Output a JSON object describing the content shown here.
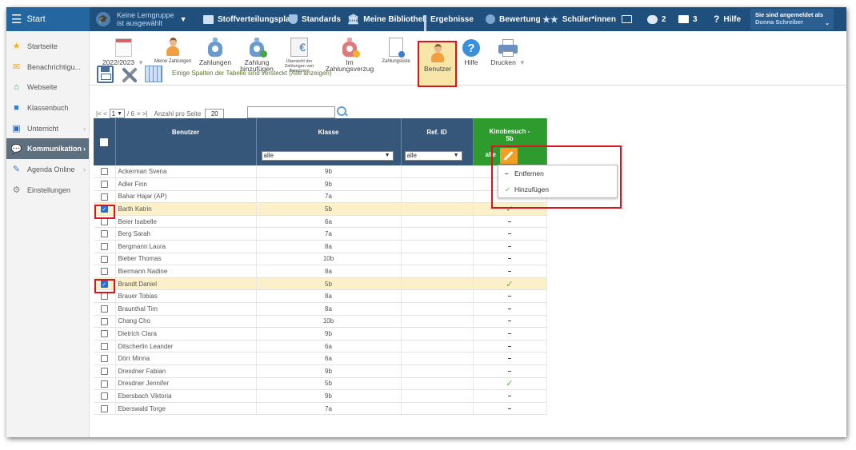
{
  "nav": {
    "start_label": "Start",
    "learning_group_line1": "Keine Lerngruppe",
    "learning_group_line2": "ist ausgewählt",
    "items": [
      {
        "label": "Stoffverteilungsplan"
      },
      {
        "label": "Standards"
      },
      {
        "label": "Meine Bibliothek"
      },
      {
        "label": "Ergebnisse"
      },
      {
        "label": "Bewertung"
      },
      {
        "label": "Schüler*innen"
      }
    ],
    "messages_count": "2",
    "notifications_count": "3",
    "help_label": "Hilfe",
    "user_title": "Sie sind angemeldet als",
    "user_name": "Donna Schreiber"
  },
  "sidebar": {
    "items": [
      {
        "label": "Startseite",
        "icon": "star-icon"
      },
      {
        "label": "Benachrichtigu...",
        "icon": "envelope-icon"
      },
      {
        "label": "Webseite",
        "icon": "home-icon"
      },
      {
        "label": "Klassenbuch",
        "icon": "book-icon"
      },
      {
        "label": "Unterricht",
        "icon": "school-icon"
      },
      {
        "label": "Kommunikation",
        "icon": "chat-icon"
      },
      {
        "label": "Agenda Online",
        "icon": "pen-icon"
      },
      {
        "label": "Einstellungen",
        "icon": "gear-icon"
      }
    ]
  },
  "toolbar": {
    "year_label": "2022/2023",
    "meine_zahlungen": "Meine Zahlungen",
    "zahlungen": "Zahlungen",
    "zahlung_hinzufuegen_1": "Zahlung",
    "zahlung_hinzufuegen_2": "hinzufügen",
    "uebersicht_1": "Übersicht der",
    "uebersicht_2": "Zahlungen von",
    "uebersicht_3": "Benutzern",
    "im_zahlungsverzug_1": "Im",
    "im_zahlungsverzug_2": "Zahlungsverzug",
    "zahlungsliste": "Zahlungsliste",
    "benutzer": "Benutzer",
    "hilfe": "Hilfe",
    "drucken": "Drucken"
  },
  "table_tools": {
    "hidden_hint": "Einige Spalten der Tabelle sind versteckt",
    "show_all": "(Alle anzeigen)"
  },
  "pager": {
    "first_prev": "|< <",
    "page": "1",
    "of": "/ 6",
    "next_last": "> >|",
    "per_page_label": "Anzahl pro Seite",
    "per_page": "20"
  },
  "table": {
    "headers": {
      "benutzer": "Benutzer",
      "klasse": "Klasse",
      "refid": "Ref. ID",
      "kino_1": "Kinobesuch -",
      "kino_2": "5b"
    },
    "filter_all": "alle",
    "rows": [
      {
        "name": "Ackerman Svena",
        "klasse": "9b",
        "kino": "",
        "selected": false
      },
      {
        "name": "Adler Finn",
        "klasse": "9b",
        "kino": "",
        "selected": false
      },
      {
        "name": "Bahar Hajar (AP)",
        "klasse": "7a",
        "kino": "",
        "selected": false
      },
      {
        "name": "Barth Katrin",
        "klasse": "5b",
        "kino": "check",
        "selected": true
      },
      {
        "name": "Beier Isabelle",
        "klasse": "6a",
        "kino": "dash",
        "selected": false
      },
      {
        "name": "Berg Sarah",
        "klasse": "7a",
        "kino": "dash",
        "selected": false
      },
      {
        "name": "Bergmann Laura",
        "klasse": "8a",
        "kino": "dash",
        "selected": false
      },
      {
        "name": "Bieber Thomas",
        "klasse": "10b",
        "kino": "dash",
        "selected": false
      },
      {
        "name": "Biermann Nadine",
        "klasse": "8a",
        "kino": "dash",
        "selected": false
      },
      {
        "name": "Brandt Daniel",
        "klasse": "5b",
        "kino": "check",
        "selected": true
      },
      {
        "name": "Brauer Tobias",
        "klasse": "8a",
        "kino": "dash",
        "selected": false
      },
      {
        "name": "Braunthal Tim",
        "klasse": "8a",
        "kino": "dash",
        "selected": false
      },
      {
        "name": "Chang Cho",
        "klasse": "10b",
        "kino": "dash",
        "selected": false
      },
      {
        "name": "Dietrich Clara",
        "klasse": "9b",
        "kino": "dash",
        "selected": false
      },
      {
        "name": "Ditscherlin Leander",
        "klasse": "6a",
        "kino": "dash",
        "selected": false
      },
      {
        "name": "Dörr Minna",
        "klasse": "6a",
        "kino": "dash",
        "selected": false
      },
      {
        "name": "Dresdner Fabian",
        "klasse": "9b",
        "kino": "dash",
        "selected": false
      },
      {
        "name": "Dresdner Jennifer",
        "klasse": "5b",
        "kino": "check",
        "selected": false
      },
      {
        "name": "Ebersbach Viktoria",
        "klasse": "9b",
        "kino": "dash",
        "selected": false
      },
      {
        "name": "Eberswald Torge",
        "klasse": "7a",
        "kino": "dash",
        "selected": false
      }
    ]
  },
  "popup": {
    "remove": "Entfernen",
    "add": "Hinzufügen"
  },
  "colors": {
    "topbar": "#1e4f7d",
    "header": "#37577a",
    "kino_header": "#2e9b2e",
    "selected_row": "#fbf0c9",
    "highlight": "#d9141b",
    "wrench": "#f29f26"
  }
}
